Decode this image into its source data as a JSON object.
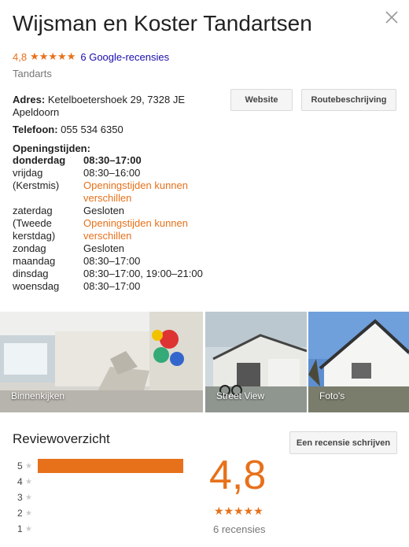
{
  "title": "Wijsman en Koster Tandartsen",
  "rating": {
    "value": "4,8",
    "stars": "★★★★★",
    "reviews_link": "6 Google-recensies",
    "stars_fraction": 0.96
  },
  "category": "Tandarts",
  "buttons": {
    "website": "Website",
    "route": "Routebeschrijving",
    "write_review": "Een recensie schrijven"
  },
  "address": {
    "label": "Adres:",
    "line1": "Ketelboetershoek 29, 7328 JE",
    "line2": "Apeldoorn"
  },
  "phone": {
    "label": "Telefoon:",
    "value": "055 534 6350"
  },
  "hours": {
    "label": "Openingstijden:",
    "rows": [
      {
        "day": "donderdag",
        "time": "08:30–17:00",
        "bold": true
      },
      {
        "day": "vrijdag",
        "time": "08:30–16:00"
      },
      {
        "day": "(Kerstmis)",
        "time": "Openingstijden kunnen verschillen",
        "note": true
      },
      {
        "day": "zaterdag",
        "time": "Gesloten"
      },
      {
        "day": "(Tweede kerstdag)",
        "time": "Openingstijden kunnen verschillen",
        "note": true
      },
      {
        "day": "zondag",
        "time": "Gesloten"
      },
      {
        "day": "maandag",
        "time": "08:30–17:00"
      },
      {
        "day": "dinsdag",
        "time": "08:30–17:00, 19:00–21:00"
      },
      {
        "day": "woensdag",
        "time": "08:30–17:00"
      }
    ]
  },
  "photos": [
    {
      "caption": "Binnenkijken"
    },
    {
      "caption": "Street View"
    },
    {
      "caption": "Foto's"
    }
  ],
  "review_overview": {
    "title": "Reviewoverzicht",
    "average": "4,8",
    "stars": "★★★★★",
    "count_label": "6 recensies",
    "distribution": [
      {
        "stars": "5",
        "fraction": 1.0
      },
      {
        "stars": "4",
        "fraction": 0.0
      },
      {
        "stars": "3",
        "fraction": 0.0
      },
      {
        "stars": "2",
        "fraction": 0.0
      },
      {
        "stars": "1",
        "fraction": 0.0
      }
    ],
    "star_glyph": "★"
  },
  "colors": {
    "accent": "#e7711b",
    "link": "#1a0dab"
  }
}
